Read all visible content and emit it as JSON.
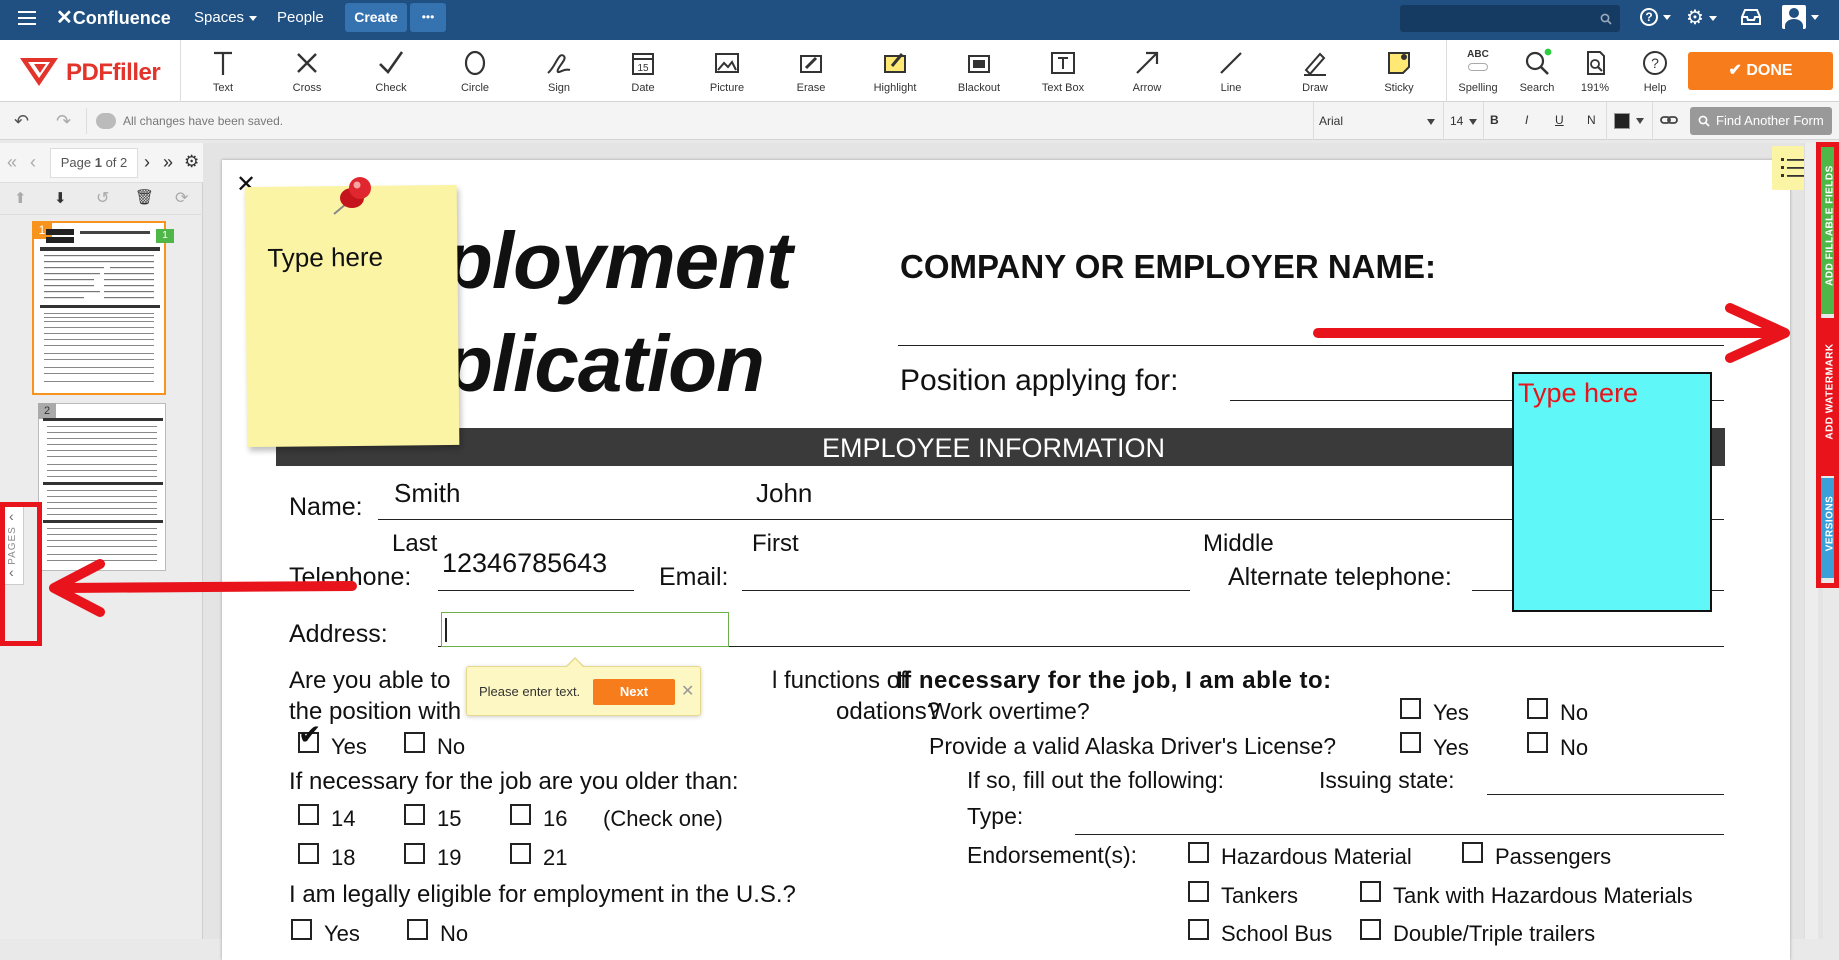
{
  "confluence": {
    "brand": "Confluence",
    "nav": [
      "Spaces",
      "People"
    ],
    "create_label": "Create",
    "more_label": "•••"
  },
  "pdffiller": {
    "logo_text": "PDFfiller",
    "tools": [
      {
        "label": "Text",
        "icon": "text-icon"
      },
      {
        "label": "Cross",
        "icon": "cross-icon"
      },
      {
        "label": "Check",
        "icon": "check-icon"
      },
      {
        "label": "Circle",
        "icon": "circle-icon"
      },
      {
        "label": "Sign",
        "icon": "sign-icon"
      },
      {
        "label": "Date",
        "icon": "calendar-icon"
      },
      {
        "label": "Picture",
        "icon": "picture-icon"
      },
      {
        "label": "Erase",
        "icon": "erase-icon"
      },
      {
        "label": "Highlight",
        "icon": "highlight-icon"
      },
      {
        "label": "Blackout",
        "icon": "blackout-icon"
      },
      {
        "label": "Text Box",
        "icon": "textbox-icon"
      },
      {
        "label": "Arrow",
        "icon": "arrow-icon"
      },
      {
        "label": "Line",
        "icon": "line-icon"
      },
      {
        "label": "Draw",
        "icon": "draw-icon"
      },
      {
        "label": "Sticky",
        "icon": "sticky-icon"
      }
    ],
    "right_tools": [
      {
        "label": "Spelling",
        "icon": "spelling-icon",
        "badge": "ABC"
      },
      {
        "label": "Search",
        "icon": "search-icon"
      },
      {
        "label": "191%",
        "icon": "zoom-icon"
      },
      {
        "label": "Help",
        "icon": "help-icon"
      }
    ],
    "done_label": "DONE",
    "status_text": "All changes have been saved.",
    "font_name": "Arial",
    "font_size": "14",
    "format_buttons": [
      "B",
      "I",
      "U",
      "N"
    ],
    "find_form_label": "Find Another Form",
    "pager": {
      "prefix": "Page",
      "current": "1",
      "suffix": "of 2"
    },
    "pages_tab_label": "PAGES",
    "thumb_numbers": [
      "1",
      "2"
    ],
    "thumb_badge": "1",
    "side_tabs": [
      "ADD FILLABLE FIELDS",
      "ADD WATERMARK",
      "VERSIONS"
    ]
  },
  "document": {
    "title_line1": "ployment",
    "title_line2": "plication",
    "company_label": "COMPANY OR EMPLOYER NAME:",
    "position_label": "Position applying for:",
    "section_header": "EMPLOYEE INFORMATION",
    "name_label": "Name:",
    "last_value": "Smith",
    "first_value": "John",
    "last_label": "Last",
    "first_label": "First",
    "middle_label": "Middle",
    "telephone_label": "Telephone:",
    "telephone_value": "12346785643",
    "email_label": "Email:",
    "alt_phone_label": "Alternate telephone:",
    "address_label": "Address:",
    "q_functions_1": "Are you able to",
    "q_functions_1b": "l functions of",
    "q_functions_2a": "the position with",
    "q_functions_2b": "odations?",
    "yes": "Yes",
    "no": "No",
    "q_older": "If necessary for the job are you older than:",
    "ages": [
      "14",
      "15",
      "16",
      "18",
      "19",
      "21"
    ],
    "check_one": "(Check one)",
    "q_eligible": "I am legally eligible for employment in the U.S.?",
    "job_able_heading": "If necessary for the job, I am able to:",
    "overtime": "Work overtime?",
    "license": "Provide a valid Alaska Driver's License?",
    "fill_following": "If so, fill out the following:",
    "issuing_state": "Issuing state:",
    "type_label": "Type:",
    "endorsements_label": "Endorsement(s):",
    "endorsements": [
      "Hazardous Material",
      "Passengers",
      "Tankers",
      "Tank with Hazardous Materials",
      "School Bus",
      "Double/Triple trailers"
    ]
  },
  "annotations": {
    "sticky_text": "Type here",
    "textbox_text": "Type here",
    "tooltip_text": "Please enter text.",
    "tooltip_next": "Next"
  },
  "colors": {
    "confluence_blue": "#205081",
    "done_orange": "#f77d1c",
    "sticky_yellow": "#fbf4a4",
    "textbox_cyan": "#5ff7f7",
    "highlight_red": "#e8131b"
  }
}
